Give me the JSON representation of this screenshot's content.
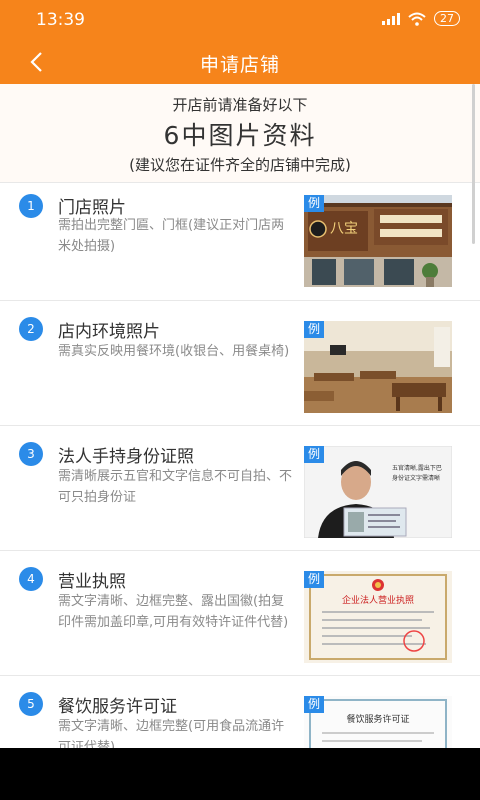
{
  "status": {
    "time": "13:39",
    "battery": "27"
  },
  "header": {
    "title": "申请店铺"
  },
  "intro": {
    "line1": "开店前请准备好以下",
    "line2": "6中图片资料",
    "line3": "(建议您在证件齐全的店铺中完成)"
  },
  "example_tag": "例",
  "items": [
    {
      "num": "1",
      "title": "门店照片",
      "desc": "需拍出完整门匾、门框(建议正对门店两米处拍摄)"
    },
    {
      "num": "2",
      "title": "店内环境照片",
      "desc": "需真实反映用餐环境(收银台、用餐桌椅)"
    },
    {
      "num": "3",
      "title": "法人手持身份证照",
      "desc": "需清晰展示五官和文字信息不可自拍、不可只拍身份证"
    },
    {
      "num": "4",
      "title": "营业执照",
      "desc": "需文字清晰、边框完整、露出国徽(拍复印件需加盖印章,可用有效特许证件代替)"
    },
    {
      "num": "5",
      "title": "餐饮服务许可证",
      "desc": "需文字清晰、边框完整(可用食品流通许可证代替)"
    }
  ],
  "thumb_text": {
    "store_sign": "八宝",
    "id_caption": "五官清晰,露出下巴",
    "id_caption2": "身份证文字需清晰",
    "license_title": "企业法人营业执照",
    "permit_title": "餐饮服务许可证"
  },
  "colors": {
    "accent": "#f6841b",
    "number_badge": "#2b8be8"
  }
}
